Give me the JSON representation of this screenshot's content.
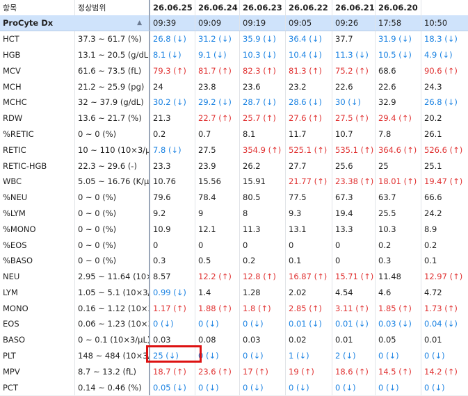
{
  "header": {
    "item_label": "항목",
    "range_label": "정상범위",
    "dates": [
      "26.06.25",
      "26.06.24",
      "26.06.23",
      "26.06.22",
      "26.06.21",
      "26.06.20",
      ""
    ]
  },
  "subheader": {
    "device": "ProCyte Dx",
    "sort_icon": "triangle-up-icon",
    "times": [
      "09:39",
      "09:09",
      "09:19",
      "09:05",
      "09:26",
      "17:58",
      "10:50"
    ]
  },
  "colors": {
    "low": "#1a82e2",
    "high": "#e03131",
    "header_bg": "#cfe3fb",
    "highlight": "#dd1111"
  },
  "rows": [
    {
      "name": "HCT",
      "range": "37.3 ~ 61.7 (%)",
      "values": [
        [
          "26.8 (↓)",
          "low"
        ],
        [
          "31.2 (↓)",
          "low"
        ],
        [
          "35.9 (↓)",
          "low"
        ],
        [
          "36.4 (↓)",
          "low"
        ],
        [
          "37.7",
          "normal"
        ],
        [
          "31.9 (↓)",
          "low"
        ],
        [
          "18.3 (↓)",
          "low"
        ]
      ]
    },
    {
      "name": "HGB",
      "range": "13.1 ~ 20.5 (g/dL)",
      "values": [
        [
          "8.1 (↓)",
          "low"
        ],
        [
          "9.1 (↓)",
          "low"
        ],
        [
          "10.3 (↓)",
          "low"
        ],
        [
          "10.4 (↓)",
          "low"
        ],
        [
          "11.3 (↓)",
          "low"
        ],
        [
          "10.5 (↓)",
          "low"
        ],
        [
          "4.9 (↓)",
          "low"
        ]
      ]
    },
    {
      "name": "MCV",
      "range": "61.6 ~ 73.5 (fL)",
      "values": [
        [
          "79.3 (↑)",
          "high"
        ],
        [
          "81.7 (↑)",
          "high"
        ],
        [
          "82.3 (↑)",
          "high"
        ],
        [
          "81.3 (↑)",
          "high"
        ],
        [
          "75.2 (↑)",
          "high"
        ],
        [
          "68.6",
          "normal"
        ],
        [
          "90.6 (↑)",
          "high"
        ]
      ]
    },
    {
      "name": "MCH",
      "range": "21.2 ~ 25.9 (pg)",
      "values": [
        [
          "24",
          "normal"
        ],
        [
          "23.8",
          "normal"
        ],
        [
          "23.6",
          "normal"
        ],
        [
          "23.2",
          "normal"
        ],
        [
          "22.6",
          "normal"
        ],
        [
          "22.6",
          "normal"
        ],
        [
          "24.3",
          "normal"
        ]
      ]
    },
    {
      "name": "MCHC",
      "range": "32 ~ 37.9 (g/dL)",
      "values": [
        [
          "30.2 (↓)",
          "low"
        ],
        [
          "29.2 (↓)",
          "low"
        ],
        [
          "28.7 (↓)",
          "low"
        ],
        [
          "28.6 (↓)",
          "low"
        ],
        [
          "30 (↓)",
          "low"
        ],
        [
          "32.9",
          "normal"
        ],
        [
          "26.8 (↓)",
          "low"
        ]
      ]
    },
    {
      "name": "RDW",
      "range": "13.6 ~ 21.7 (%)",
      "values": [
        [
          "21.3",
          "normal"
        ],
        [
          "22.7 (↑)",
          "high"
        ],
        [
          "25.7 (↑)",
          "high"
        ],
        [
          "27.6 (↑)",
          "high"
        ],
        [
          "27.5 (↑)",
          "high"
        ],
        [
          "29.4 (↑)",
          "high"
        ],
        [
          "20.2",
          "normal"
        ]
      ]
    },
    {
      "name": "%RETIC",
      "range": "0 ~ 0 (%)",
      "values": [
        [
          "0.2",
          "normal"
        ],
        [
          "0.7",
          "normal"
        ],
        [
          "8.1",
          "normal"
        ],
        [
          "11.7",
          "normal"
        ],
        [
          "10.7",
          "normal"
        ],
        [
          "7.8",
          "normal"
        ],
        [
          "26.1",
          "normal"
        ]
      ]
    },
    {
      "name": "RETIC",
      "range": "10 ~ 110 (10×3/μL",
      "values": [
        [
          "7.8 (↓)",
          "low"
        ],
        [
          "27.5",
          "normal"
        ],
        [
          "354.9 (↑)",
          "high"
        ],
        [
          "525.1 (↑)",
          "high"
        ],
        [
          "535.1 (↑)",
          "high"
        ],
        [
          "364.6 (↑)",
          "high"
        ],
        [
          "526.6 (↑)",
          "high"
        ]
      ]
    },
    {
      "name": "RETIC-HGB",
      "range": "22.3 ~ 29.6 (-)",
      "values": [
        [
          "23.3",
          "normal"
        ],
        [
          "23.9",
          "normal"
        ],
        [
          "26.2",
          "normal"
        ],
        [
          "27.7",
          "normal"
        ],
        [
          "25.6",
          "normal"
        ],
        [
          "25",
          "normal"
        ],
        [
          "25.1",
          "normal"
        ]
      ]
    },
    {
      "name": "WBC",
      "range": "5.05 ~ 16.76 (K/μl",
      "values": [
        [
          "10.76",
          "normal"
        ],
        [
          "15.56",
          "normal"
        ],
        [
          "15.91",
          "normal"
        ],
        [
          "21.77 (↑)",
          "high"
        ],
        [
          "23.38 (↑)",
          "high"
        ],
        [
          "18.01 (↑)",
          "high"
        ],
        [
          "19.47 (↑)",
          "high"
        ]
      ]
    },
    {
      "name": "%NEU",
      "range": "0 ~ 0 (%)",
      "values": [
        [
          "79.6",
          "normal"
        ],
        [
          "78.4",
          "normal"
        ],
        [
          "80.5",
          "normal"
        ],
        [
          "77.5",
          "normal"
        ],
        [
          "67.3",
          "normal"
        ],
        [
          "63.7",
          "normal"
        ],
        [
          "66.6",
          "normal"
        ]
      ]
    },
    {
      "name": "%LYM",
      "range": "0 ~ 0 (%)",
      "values": [
        [
          "9.2",
          "normal"
        ],
        [
          "9",
          "normal"
        ],
        [
          "8",
          "normal"
        ],
        [
          "9.3",
          "normal"
        ],
        [
          "19.4",
          "normal"
        ],
        [
          "25.5",
          "normal"
        ],
        [
          "24.2",
          "normal"
        ]
      ]
    },
    {
      "name": "%MONO",
      "range": "0 ~ 0 (%)",
      "values": [
        [
          "10.9",
          "normal"
        ],
        [
          "12.1",
          "normal"
        ],
        [
          "11.3",
          "normal"
        ],
        [
          "13.1",
          "normal"
        ],
        [
          "13.3",
          "normal"
        ],
        [
          "10.3",
          "normal"
        ],
        [
          "8.9",
          "normal"
        ]
      ]
    },
    {
      "name": "%EOS",
      "range": "0 ~ 0 (%)",
      "values": [
        [
          "0",
          "normal"
        ],
        [
          "0",
          "normal"
        ],
        [
          "0",
          "normal"
        ],
        [
          "0",
          "normal"
        ],
        [
          "0",
          "normal"
        ],
        [
          "0.2",
          "normal"
        ],
        [
          "0.2",
          "normal"
        ]
      ]
    },
    {
      "name": "%BASO",
      "range": "0 ~ 0 (%)",
      "values": [
        [
          "0.3",
          "normal"
        ],
        [
          "0.5",
          "normal"
        ],
        [
          "0.2",
          "normal"
        ],
        [
          "0.1",
          "normal"
        ],
        [
          "0",
          "normal"
        ],
        [
          "0.3",
          "normal"
        ],
        [
          "0.1",
          "normal"
        ]
      ]
    },
    {
      "name": "NEU",
      "range": "2.95 ~ 11.64 (10×:",
      "values": [
        [
          "8.57",
          "normal"
        ],
        [
          "12.2 (↑)",
          "high"
        ],
        [
          "12.8 (↑)",
          "high"
        ],
        [
          "16.87 (↑)",
          "high"
        ],
        [
          "15.71 (↑)",
          "high"
        ],
        [
          "11.48",
          "normal"
        ],
        [
          "12.97 (↑)",
          "high"
        ]
      ]
    },
    {
      "name": "LYM",
      "range": "1.05 ~ 5.1 (10×3/μ",
      "values": [
        [
          "0.99 (↓)",
          "low"
        ],
        [
          "1.4",
          "normal"
        ],
        [
          "1.28",
          "normal"
        ],
        [
          "2.02",
          "normal"
        ],
        [
          "4.54",
          "normal"
        ],
        [
          "4.6",
          "normal"
        ],
        [
          "4.72",
          "normal"
        ]
      ]
    },
    {
      "name": "MONO",
      "range": "0.16 ~ 1.12 (10×3/|",
      "values": [
        [
          "1.17 (↑)",
          "high"
        ],
        [
          "1.88 (↑)",
          "high"
        ],
        [
          "1.8 (↑)",
          "high"
        ],
        [
          "2.85 (↑)",
          "high"
        ],
        [
          "3.11 (↑)",
          "high"
        ],
        [
          "1.85 (↑)",
          "high"
        ],
        [
          "1.73 (↑)",
          "high"
        ]
      ]
    },
    {
      "name": "EOS",
      "range": "0.06 ~ 1.23 (10×3",
      "values": [
        [
          "0 (↓)",
          "low"
        ],
        [
          "0 (↓)",
          "low"
        ],
        [
          "0 (↓)",
          "low"
        ],
        [
          "0.01 (↓)",
          "low"
        ],
        [
          "0.01 (↓)",
          "low"
        ],
        [
          "0.03 (↓)",
          "low"
        ],
        [
          "0.04 (↓)",
          "low"
        ]
      ]
    },
    {
      "name": "BASO",
      "range": "0 ~ 0.1 (10×3/μL)",
      "values": [
        [
          "0.03",
          "normal"
        ],
        [
          "0.08",
          "normal"
        ],
        [
          "0.03",
          "normal"
        ],
        [
          "0.02",
          "normal"
        ],
        [
          "0.01",
          "normal"
        ],
        [
          "0.05",
          "normal"
        ],
        [
          "0.01",
          "normal"
        ]
      ]
    },
    {
      "name": "PLT",
      "range": "148 ~ 484 (10×3/",
      "values": [
        [
          "25 (↓)",
          "low"
        ],
        [
          "0 (↓)",
          "low"
        ],
        [
          "0 (↓)",
          "low"
        ],
        [
          "1 (↓)",
          "low"
        ],
        [
          "2 (↓)",
          "low"
        ],
        [
          "0 (↓)",
          "low"
        ],
        [
          "0 (↓)",
          "low"
        ]
      ]
    },
    {
      "name": "MPV",
      "range": "8.7 ~ 13.2 (fL)",
      "values": [
        [
          "18.7 (↑)",
          "high"
        ],
        [
          "23.6 (↑)",
          "high"
        ],
        [
          "17 (↑)",
          "high"
        ],
        [
          "19 (↑)",
          "high"
        ],
        [
          "18.6 (↑)",
          "high"
        ],
        [
          "14.5 (↑)",
          "high"
        ],
        [
          "14.2 (↑)",
          "high"
        ]
      ]
    },
    {
      "name": "PCT",
      "range": "0.14 ~ 0.46 (%)",
      "values": [
        [
          "0.05 (↓)",
          "low"
        ],
        [
          "0 (↓)",
          "low"
        ],
        [
          "0 (↓)",
          "low"
        ],
        [
          "0 (↓)",
          "low"
        ],
        [
          "0 (↓)",
          "low"
        ],
        [
          "0 (↓)",
          "low"
        ],
        [
          "0 (↓)",
          "low"
        ]
      ]
    }
  ]
}
